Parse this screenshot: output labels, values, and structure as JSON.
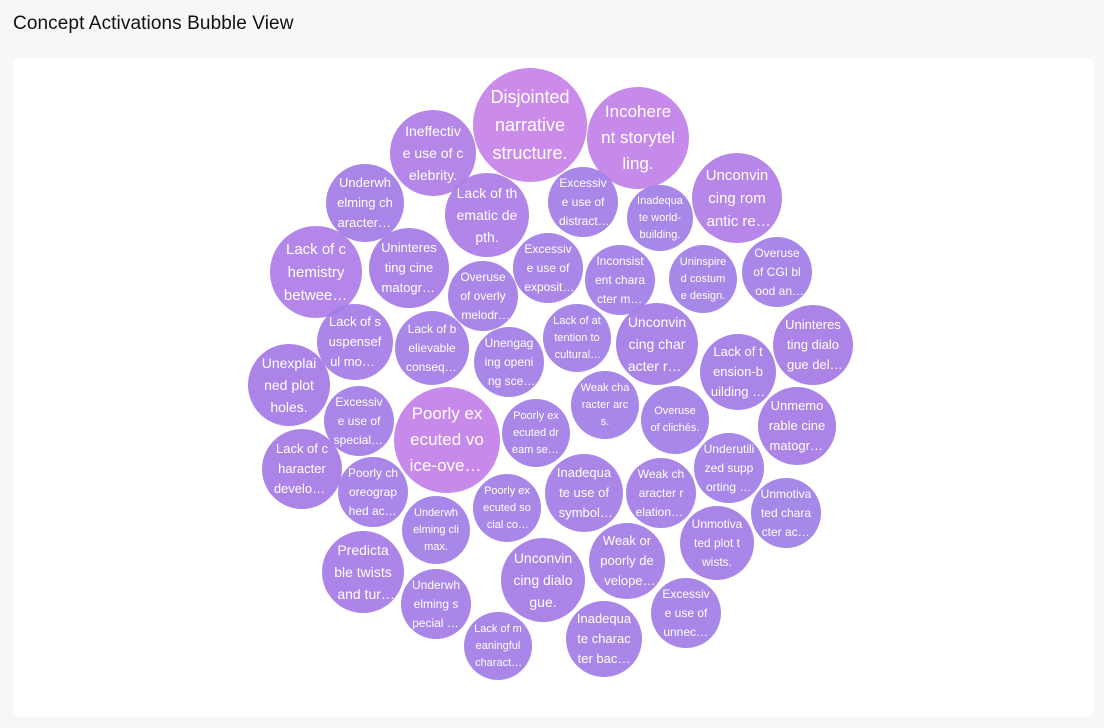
{
  "page": {
    "title": "Concept Activations Bubble View"
  },
  "palette": {
    "low": "#9c81e6",
    "mid": "#a67be6",
    "high": "#c682e8"
  },
  "bubbles": [
    {
      "label": "Disjointed narrative structure.",
      "activation": 1.0
    },
    {
      "label": "Incoherent storytelling.",
      "activation": 0.92
    },
    {
      "label": "Poorly executed voice-over narration.",
      "activation": 0.95
    },
    {
      "label": "Ineffective use of celebrity.",
      "activation": 0.62
    },
    {
      "label": "Lack of thematic depth.",
      "activation": 0.6
    },
    {
      "label": "Unconvincing romantic relationship.",
      "activation": 0.66
    },
    {
      "label": "Lack of chemistry between leads.",
      "activation": 0.64
    },
    {
      "label": "Underwhelming character motivations.",
      "activation": 0.4
    },
    {
      "label": "Excessive use of distracting effects.",
      "activation": 0.28
    },
    {
      "label": "Inadequate world-building.",
      "activation": 0.22
    },
    {
      "label": "Uninteresting cinematography.",
      "activation": 0.48
    },
    {
      "label": "Excessive use of exposition.",
      "activation": 0.3
    },
    {
      "label": "Inconsistent character motivation.",
      "activation": 0.26
    },
    {
      "label": "Uninspired costume design.",
      "activation": 0.18
    },
    {
      "label": "Overuse of CGI blood and gore.",
      "activation": 0.25
    },
    {
      "label": "Overuse of overly melodramatic acting.",
      "activation": 0.3
    },
    {
      "label": "Lack of suspenseful moments.",
      "activation": 0.44
    },
    {
      "label": "Lack of believable consequences for actions.",
      "activation": 0.36
    },
    {
      "label": "Unengaging opening scene.",
      "activation": 0.24
    },
    {
      "label": "Lack of attention to cultural authenticity.",
      "activation": 0.24
    },
    {
      "label": "Unconvincing character relationships.",
      "activation": 0.46
    },
    {
      "label": "Lack of tension-building scenes.",
      "activation": 0.4
    },
    {
      "label": "Uninteresting dialogue delivery.",
      "activation": 0.48
    },
    {
      "label": "Unexplained plot holes.",
      "activation": 0.5
    },
    {
      "label": "Excessive use of special effects.",
      "activation": 0.3
    },
    {
      "label": "Poorly executed dream sequences.",
      "activation": 0.26
    },
    {
      "label": "Weak character arcs.",
      "activation": 0.22
    },
    {
      "label": "Overuse of clichés.",
      "activation": 0.2
    },
    {
      "label": "Unmemorable cinematography.",
      "activation": 0.5
    },
    {
      "label": "Lack of character development.",
      "activation": 0.5
    },
    {
      "label": "Poorly choreographed action sequences.",
      "activation": 0.3
    },
    {
      "label": "Underwhelming climax.",
      "activation": 0.18
    },
    {
      "label": "Poorly executed social commentary.",
      "activation": 0.26
    },
    {
      "label": "Inadequate use of symbolism.",
      "activation": 0.34
    },
    {
      "label": "Weak character relationships.",
      "activation": 0.3
    },
    {
      "label": "Underutilized supporting cast.",
      "activation": 0.24
    },
    {
      "label": "Unmotivated character actions.",
      "activation": 0.12
    },
    {
      "label": "Unmotivated plot twists.",
      "activation": 0.4
    },
    {
      "label": "Predictable twists and turns.",
      "activation": 0.52
    },
    {
      "label": "Underwhelming special effects.",
      "activation": 0.3
    },
    {
      "label": "Unconvincing dialogue.",
      "activation": 0.46
    },
    {
      "label": "Weak or poorly developed villain.",
      "activation": 0.32
    },
    {
      "label": "Excessive use of unnecessary subplots.",
      "activation": 0.24
    },
    {
      "label": "Lack of meaningful character interactions.",
      "activation": 0.26
    },
    {
      "label": "Inadequate character backstory.",
      "activation": 0.3
    }
  ]
}
